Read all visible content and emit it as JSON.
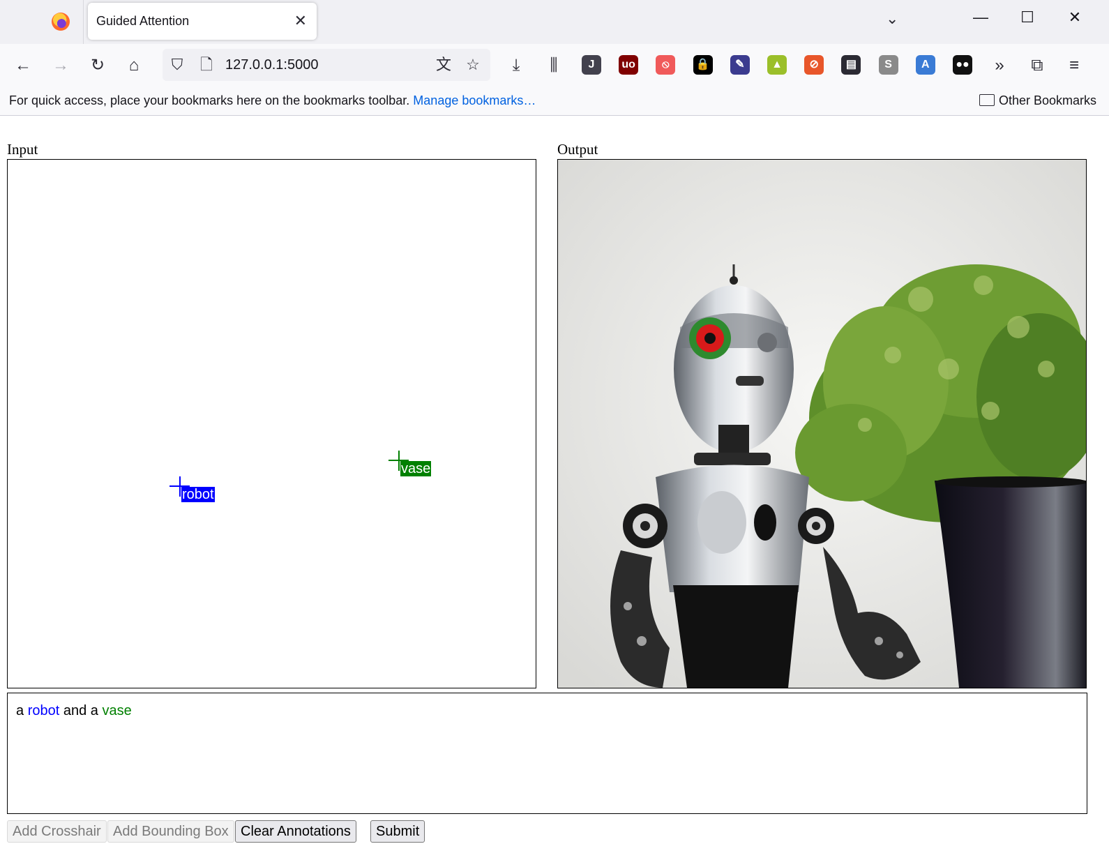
{
  "browser": {
    "tab_title": "Guided Attention",
    "url": "127.0.0.1:5000",
    "bookmarks_hint": "For quick access, place your bookmarks here on the bookmarks toolbar.",
    "manage_bookmarks": "Manage bookmarks…",
    "other_bookmarks": "Other Bookmarks",
    "extensions": [
      {
        "name": "j-extension-icon",
        "letter": "J",
        "color": "#42414d"
      },
      {
        "name": "ublock-icon",
        "letter": "uo",
        "color": "#800000"
      },
      {
        "name": "privacy-shield-icon",
        "letter": "⦸",
        "color": "#f05a5a"
      },
      {
        "name": "lock-extension-icon",
        "letter": "🔒",
        "color": "#000000"
      },
      {
        "name": "eyedropper-icon",
        "letter": "✎",
        "color": "#3b3b8f"
      },
      {
        "name": "plant-extension-icon",
        "letter": "▲",
        "color": "#9bbf2a"
      },
      {
        "name": "block-extension-icon",
        "letter": "⊘",
        "color": "#e8562a"
      },
      {
        "name": "reader-extension-icon",
        "letter": "▤",
        "color": "#2b2a33"
      },
      {
        "name": "s-extension-icon",
        "letter": "S",
        "color": "#8a8a8a"
      },
      {
        "name": "translate-extension-icon",
        "letter": "A",
        "color": "#3a7bd5"
      },
      {
        "name": "tampermonkey-icon",
        "letter": "●●",
        "color": "#111111"
      }
    ]
  },
  "page": {
    "input_label": "Input",
    "output_label": "Output",
    "markers": [
      {
        "label": "robot",
        "color": "#0000ff"
      },
      {
        "label": "vase",
        "color": "#008000"
      }
    ],
    "prompt": {
      "parts": [
        {
          "text": "a",
          "color": "#000000"
        },
        {
          "text": "robot",
          "color": "#0000ff"
        },
        {
          "text": "and a",
          "color": "#000000"
        },
        {
          "text": "vase",
          "color": "#008000"
        }
      ]
    },
    "buttons": {
      "add_crosshair": "Add Crosshair",
      "add_bounding_box": "Add Bounding Box",
      "clear_annotations": "Clear Annotations",
      "submit": "Submit"
    }
  }
}
